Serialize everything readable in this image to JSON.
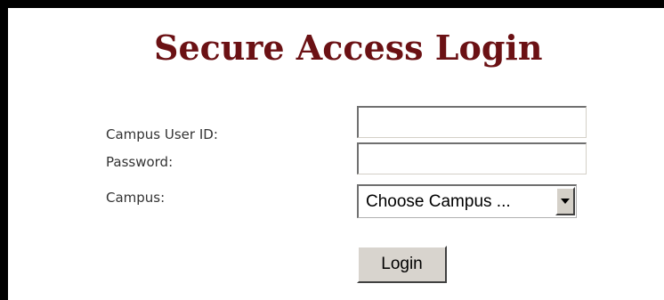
{
  "header": {
    "title": "Secure Access Login"
  },
  "form": {
    "user_id_label": "Campus User ID:",
    "user_id_value": "",
    "password_label": "Password:",
    "password_value": "",
    "campus_label": "Campus:",
    "campus_selected": "Choose Campus ...",
    "login_label": "Login"
  },
  "colors": {
    "title": "#6b1114",
    "frame": "#000000",
    "button_face": "#d8d4ce"
  },
  "icons": {
    "campus_dropdown": "chevron-down-icon"
  }
}
